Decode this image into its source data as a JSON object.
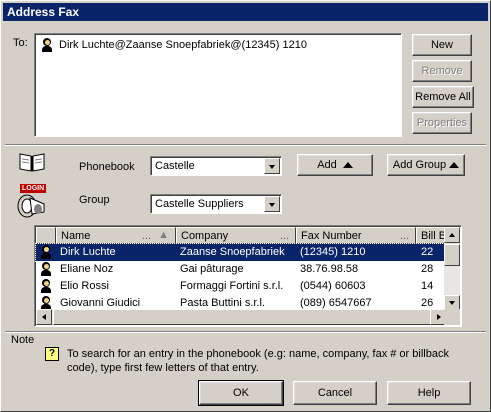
{
  "window": {
    "title": "Address Fax"
  },
  "to": {
    "label": "To:",
    "recipients": [
      "Dirk Luchte@Zaanse Snoepfabriek@(12345) 1210"
    ]
  },
  "side_buttons": {
    "new": "New",
    "remove": "Remove",
    "remove_all": "Remove All",
    "properties": "Properties"
  },
  "phonebook": {
    "label": "Phonebook",
    "value": "Castelle",
    "add_label": "Add",
    "add_group_label": "Add Group"
  },
  "group": {
    "label": "Group",
    "value": "Castelle Suppliers",
    "login_badge": "LOGIN"
  },
  "table": {
    "columns": [
      "Name",
      "Company",
      "Fax Number",
      "Bill B"
    ],
    "rows": [
      {
        "name": "Dirk Luchte",
        "company": "Zaanse Snoepfabriek",
        "fax": "(12345) 1210",
        "bill": "22",
        "selected": true
      },
      {
        "name": "Eliane Noz",
        "company": "Gai pâturage",
        "fax": "38.76.98.58",
        "bill": "28",
        "selected": false
      },
      {
        "name": "Elio Rossi",
        "company": "Formaggi Fortini s.r.l.",
        "fax": "(0544) 60603",
        "bill": "14",
        "selected": false
      },
      {
        "name": "Giovanni Giudici",
        "company": "Pasta Buttini s.r.l.",
        "fax": "(089) 6547667",
        "bill": "26",
        "selected": false
      }
    ]
  },
  "note": {
    "label": "Note",
    "text": "To search for an entry in the phonebook (e.g: name, company, fax # or billback code), type first few letters of that entry."
  },
  "footer": {
    "ok": "OK",
    "cancel": "Cancel",
    "help": "Help"
  }
}
